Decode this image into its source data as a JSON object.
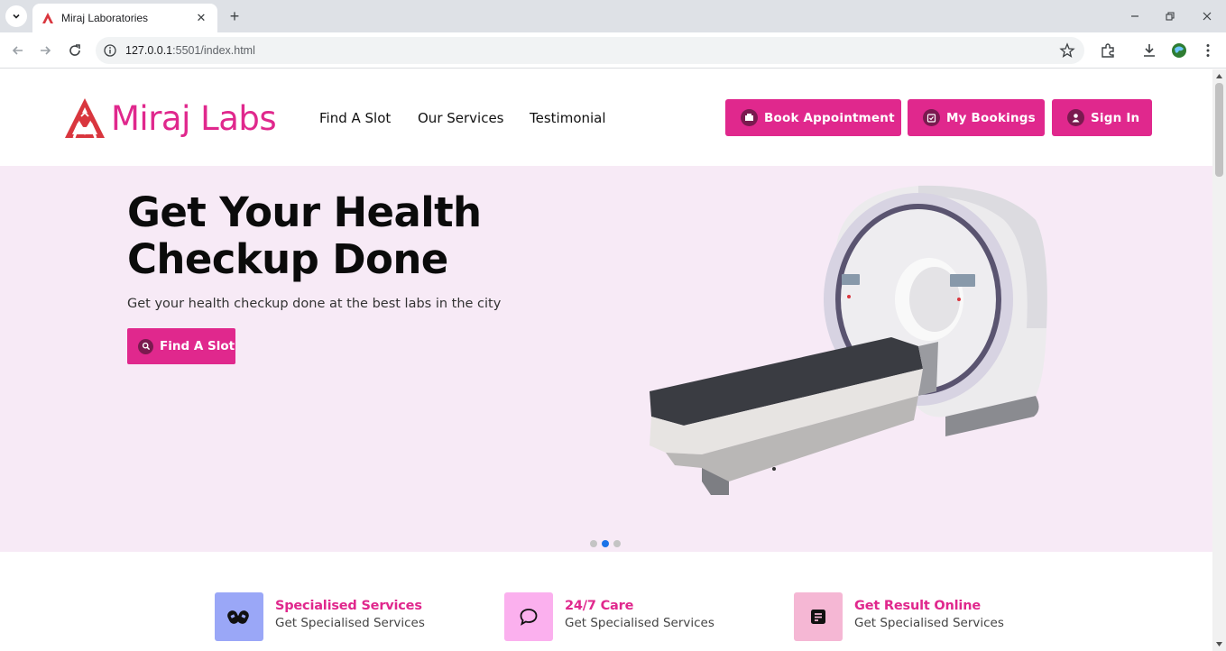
{
  "browser": {
    "tab_title": "Miraj Laboratories",
    "url_host": "127.0.0.1",
    "url_rest": ":5501/index.html"
  },
  "header": {
    "brand": "Miraj Labs",
    "nav": [
      "Find A Slot",
      "Our Services",
      "Testimonial"
    ],
    "buttons": {
      "book": "Book Appointment",
      "bookings": "My Bookings",
      "signin": "Sign In"
    }
  },
  "hero": {
    "title_line1": "Get Your Health",
    "title_line2": "Checkup Done",
    "subtitle": "Get your health checkup done at the best labs in the city",
    "cta": "Find A Slot",
    "carousel": {
      "slides": 3,
      "active_index": 1
    }
  },
  "features": [
    {
      "title": "Specialised Services",
      "subtitle": "Get Specialised Services",
      "icon": "pills-icon",
      "icon_bg": "#9aa7f7"
    },
    {
      "title": "24/7 Care",
      "subtitle": "Get Specialised Services",
      "icon": "chat-bubble-icon",
      "icon_bg": "#fbb0ee"
    },
    {
      "title": "Get Result Online",
      "subtitle": "Get Specialised Services",
      "icon": "document-icon",
      "icon_bg": "#f5b7d4"
    }
  ],
  "colors": {
    "brand": "#e0288d",
    "hero_bg": "#f7eaf6",
    "carousel_active": "#1a73e8"
  }
}
